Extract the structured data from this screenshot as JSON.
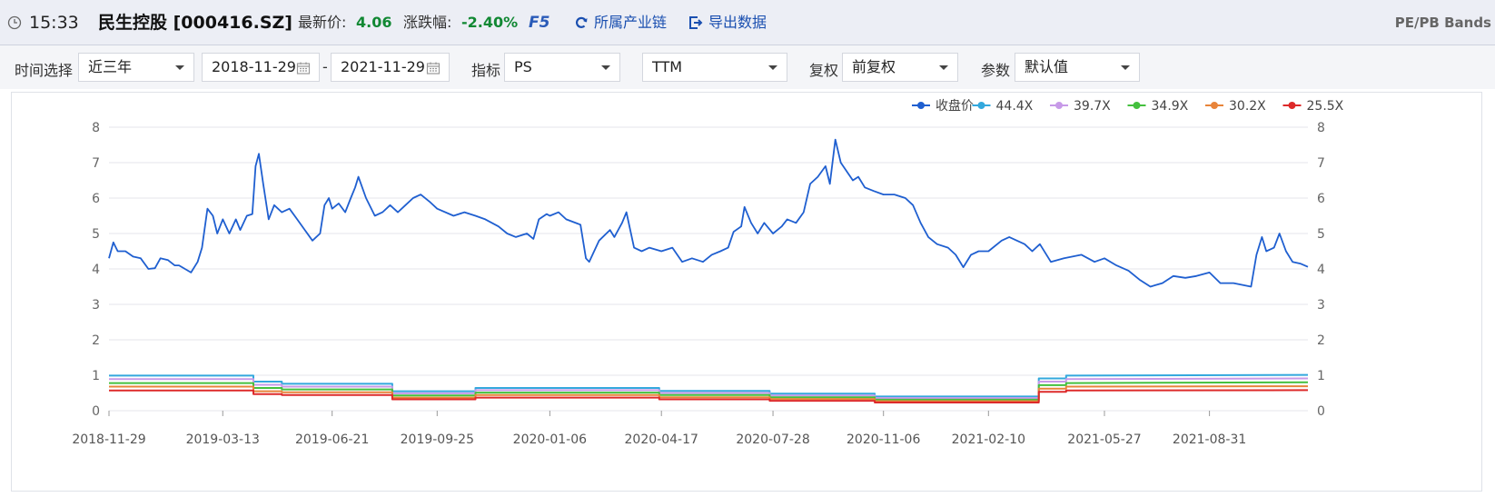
{
  "header": {
    "time": "15:33",
    "stock": "民生控股 [000416.SZ]",
    "price_label": "最新价:",
    "price_value": "4.06",
    "change_label": "涨跌幅:",
    "change_value": "-2.40%",
    "f5": "F5",
    "chain_link": "所属产业链",
    "export_link": "导出数据",
    "bands_title": "PE/PB Bands",
    "icons": {
      "clock": "clock-icon",
      "chain": "refresh-icon",
      "export": "export-icon"
    },
    "colors": {
      "positive": "#118833",
      "link": "#1a4fb0"
    }
  },
  "toolbar": {
    "time_label": "时间选择",
    "range_value": "近三年",
    "start_date": "2018-11-29",
    "date_dash": "-",
    "end_date": "2021-11-29",
    "metric_label": "指标",
    "metric_value": "PS",
    "period_value": "TTM",
    "adjust_label": "复权",
    "adjust_value": "前复权",
    "param_label": "参数",
    "param_value": "默认值"
  },
  "chart_data": {
    "type": "line",
    "x_ticks": [
      "2018-11-29",
      "2019-03-13",
      "2019-06-21",
      "2019-09-25",
      "2020-01-06",
      "2020-04-17",
      "2020-07-28",
      "2020-11-06",
      "2021-02-10",
      "2021-05-27",
      "2021-08-31"
    ],
    "ylim": [
      0,
      8
    ],
    "y_ticks": [
      0,
      1,
      2,
      3,
      4,
      5,
      6,
      7,
      8
    ],
    "grid": true,
    "legend_position": "top-right",
    "series": [
      {
        "name": "收盘价",
        "color": "#1f5fd0",
        "type": "close",
        "points": [
          [
            "2018-11-29",
            4.3
          ],
          [
            "2018-12-03",
            4.75
          ],
          [
            "2018-12-07",
            4.5
          ],
          [
            "2018-12-14",
            4.5
          ],
          [
            "2018-12-21",
            4.35
          ],
          [
            "2018-12-28",
            4.3
          ],
          [
            "2019-01-04",
            4.0
          ],
          [
            "2019-01-10",
            4.02
          ],
          [
            "2019-01-15",
            4.3
          ],
          [
            "2019-01-22",
            4.25
          ],
          [
            "2019-01-28",
            4.1
          ],
          [
            "2019-02-01",
            4.1
          ],
          [
            "2019-02-12",
            3.9
          ],
          [
            "2019-02-18",
            4.2
          ],
          [
            "2019-02-22",
            4.6
          ],
          [
            "2019-02-27",
            5.7
          ],
          [
            "2019-03-04",
            5.5
          ],
          [
            "2019-03-08",
            5.0
          ],
          [
            "2019-03-13",
            5.4
          ],
          [
            "2019-03-19",
            5.0
          ],
          [
            "2019-03-25",
            5.4
          ],
          [
            "2019-03-29",
            5.1
          ],
          [
            "2019-04-04",
            5.5
          ],
          [
            "2019-04-09",
            5.55
          ],
          [
            "2019-04-12",
            6.9
          ],
          [
            "2019-04-15",
            7.25
          ],
          [
            "2019-04-19",
            6.4
          ],
          [
            "2019-04-24",
            5.4
          ],
          [
            "2019-04-29",
            5.8
          ],
          [
            "2019-05-06",
            5.6
          ],
          [
            "2019-05-13",
            5.7
          ],
          [
            "2019-05-20",
            5.4
          ],
          [
            "2019-05-27",
            5.1
          ],
          [
            "2019-06-03",
            4.8
          ],
          [
            "2019-06-10",
            5.0
          ],
          [
            "2019-06-14",
            5.8
          ],
          [
            "2019-06-18",
            6.0
          ],
          [
            "2019-06-21",
            5.7
          ],
          [
            "2019-06-27",
            5.85
          ],
          [
            "2019-07-03",
            5.6
          ],
          [
            "2019-07-08",
            6.0
          ],
          [
            "2019-07-12",
            6.3
          ],
          [
            "2019-07-15",
            6.6
          ],
          [
            "2019-07-22",
            6.0
          ],
          [
            "2019-07-30",
            5.5
          ],
          [
            "2019-08-06",
            5.6
          ],
          [
            "2019-08-13",
            5.8
          ],
          [
            "2019-08-20",
            5.6
          ],
          [
            "2019-08-27",
            5.8
          ],
          [
            "2019-09-03",
            6.0
          ],
          [
            "2019-09-10",
            6.1
          ],
          [
            "2019-09-18",
            5.9
          ],
          [
            "2019-09-25",
            5.7
          ],
          [
            "2019-10-10",
            5.5
          ],
          [
            "2019-10-20",
            5.6
          ],
          [
            "2019-10-30",
            5.5
          ],
          [
            "2019-11-08",
            5.4
          ],
          [
            "2019-11-20",
            5.2
          ],
          [
            "2019-11-28",
            5.0
          ],
          [
            "2019-12-06",
            4.9
          ],
          [
            "2019-12-16",
            5.0
          ],
          [
            "2019-12-22",
            4.85
          ],
          [
            "2019-12-27",
            5.4
          ],
          [
            "2020-01-03",
            5.55
          ],
          [
            "2020-01-06",
            5.5
          ],
          [
            "2020-01-14",
            5.6
          ],
          [
            "2020-01-21",
            5.4
          ],
          [
            "2020-02-03",
            5.25
          ],
          [
            "2020-02-08",
            4.3
          ],
          [
            "2020-02-11",
            4.2
          ],
          [
            "2020-02-20",
            4.8
          ],
          [
            "2020-03-01",
            5.1
          ],
          [
            "2020-03-05",
            4.9
          ],
          [
            "2020-03-12",
            5.3
          ],
          [
            "2020-03-16",
            5.6
          ],
          [
            "2020-03-23",
            4.6
          ],
          [
            "2020-03-30",
            4.5
          ],
          [
            "2020-04-06",
            4.6
          ],
          [
            "2020-04-17",
            4.5
          ],
          [
            "2020-04-27",
            4.6
          ],
          [
            "2020-05-06",
            4.2
          ],
          [
            "2020-05-15",
            4.3
          ],
          [
            "2020-05-25",
            4.2
          ],
          [
            "2020-06-02",
            4.4
          ],
          [
            "2020-06-10",
            4.5
          ],
          [
            "2020-06-17",
            4.6
          ],
          [
            "2020-06-22",
            5.05
          ],
          [
            "2020-06-29",
            5.2
          ],
          [
            "2020-07-02",
            5.75
          ],
          [
            "2020-07-08",
            5.3
          ],
          [
            "2020-07-14",
            5.0
          ],
          [
            "2020-07-20",
            5.3
          ],
          [
            "2020-07-28",
            5.0
          ],
          [
            "2020-08-05",
            5.2
          ],
          [
            "2020-08-10",
            5.4
          ],
          [
            "2020-08-18",
            5.3
          ],
          [
            "2020-08-25",
            5.6
          ],
          [
            "2020-08-31",
            6.4
          ],
          [
            "2020-09-07",
            6.6
          ],
          [
            "2020-09-14",
            6.9
          ],
          [
            "2020-09-18",
            6.4
          ],
          [
            "2020-09-23",
            7.65
          ],
          [
            "2020-09-28",
            7.0
          ],
          [
            "2020-10-09",
            6.5
          ],
          [
            "2020-10-14",
            6.6
          ],
          [
            "2020-10-20",
            6.3
          ],
          [
            "2020-10-28",
            6.2
          ],
          [
            "2020-11-06",
            6.1
          ],
          [
            "2020-11-16",
            6.1
          ],
          [
            "2020-11-26",
            6.0
          ],
          [
            "2020-12-03",
            5.8
          ],
          [
            "2020-12-10",
            5.3
          ],
          [
            "2020-12-17",
            4.9
          ],
          [
            "2020-12-25",
            4.7
          ],
          [
            "2021-01-04",
            4.6
          ],
          [
            "2021-01-11",
            4.4
          ],
          [
            "2021-01-18",
            4.05
          ],
          [
            "2021-01-25",
            4.4
          ],
          [
            "2021-02-01",
            4.5
          ],
          [
            "2021-02-10",
            4.5
          ],
          [
            "2021-02-22",
            4.8
          ],
          [
            "2021-03-01",
            4.9
          ],
          [
            "2021-03-08",
            4.8
          ],
          [
            "2021-03-15",
            4.7
          ],
          [
            "2021-03-22",
            4.5
          ],
          [
            "2021-03-29",
            4.7
          ],
          [
            "2021-04-08",
            4.2
          ],
          [
            "2021-04-20",
            4.3
          ],
          [
            "2021-05-06",
            4.4
          ],
          [
            "2021-05-18",
            4.2
          ],
          [
            "2021-05-27",
            4.3
          ],
          [
            "2021-06-07",
            4.1
          ],
          [
            "2021-06-18",
            3.95
          ],
          [
            "2021-06-28",
            3.7
          ],
          [
            "2021-07-08",
            3.5
          ],
          [
            "2021-07-19",
            3.6
          ],
          [
            "2021-07-29",
            3.8
          ],
          [
            "2021-08-09",
            3.75
          ],
          [
            "2021-08-19",
            3.8
          ],
          [
            "2021-08-31",
            3.9
          ],
          [
            "2021-09-10",
            3.6
          ],
          [
            "2021-09-22",
            3.6
          ],
          [
            "2021-10-08",
            3.5
          ],
          [
            "2021-10-13",
            4.4
          ],
          [
            "2021-10-18",
            4.9
          ],
          [
            "2021-10-22",
            4.5
          ],
          [
            "2021-10-29",
            4.6
          ],
          [
            "2021-11-03",
            5.0
          ],
          [
            "2021-11-09",
            4.5
          ],
          [
            "2021-11-15",
            4.2
          ],
          [
            "2021-11-22",
            4.15
          ],
          [
            "2021-11-29",
            4.06
          ]
        ]
      },
      {
        "name": "44.4X",
        "color": "#33a8dd",
        "type": "band",
        "points": [
          [
            "2018-11-29",
            0.99
          ],
          [
            "2019-04-10",
            0.99
          ],
          [
            "2019-04-10",
            0.82
          ],
          [
            "2019-05-06",
            0.82
          ],
          [
            "2019-05-06",
            0.76
          ],
          [
            "2019-08-15",
            0.76
          ],
          [
            "2019-08-15",
            0.55
          ],
          [
            "2019-10-30",
            0.55
          ],
          [
            "2019-10-30",
            0.64
          ],
          [
            "2020-04-15",
            0.64
          ],
          [
            "2020-04-15",
            0.56
          ],
          [
            "2020-07-25",
            0.56
          ],
          [
            "2020-07-25",
            0.48
          ],
          [
            "2020-10-29",
            0.48
          ],
          [
            "2020-10-29",
            0.4
          ],
          [
            "2021-03-28",
            0.4
          ],
          [
            "2021-03-28",
            0.91
          ],
          [
            "2021-04-22",
            0.91
          ],
          [
            "2021-04-22",
            0.99
          ],
          [
            "2021-11-29",
            1.01
          ]
        ]
      },
      {
        "name": "39.7X",
        "color": "#c79ae8",
        "type": "band",
        "points": [
          [
            "2018-11-29",
            0.89
          ],
          [
            "2019-04-10",
            0.89
          ],
          [
            "2019-04-10",
            0.73
          ],
          [
            "2019-05-06",
            0.73
          ],
          [
            "2019-05-06",
            0.68
          ],
          [
            "2019-08-15",
            0.68
          ],
          [
            "2019-08-15",
            0.49
          ],
          [
            "2019-10-30",
            0.49
          ],
          [
            "2019-10-30",
            0.58
          ],
          [
            "2020-04-15",
            0.58
          ],
          [
            "2020-04-15",
            0.5
          ],
          [
            "2020-07-25",
            0.5
          ],
          [
            "2020-07-25",
            0.43
          ],
          [
            "2020-10-29",
            0.43
          ],
          [
            "2020-10-29",
            0.36
          ],
          [
            "2021-03-28",
            0.36
          ],
          [
            "2021-03-28",
            0.82
          ],
          [
            "2021-04-22",
            0.82
          ],
          [
            "2021-04-22",
            0.89
          ],
          [
            "2021-11-29",
            0.91
          ]
        ]
      },
      {
        "name": "34.9X",
        "color": "#44c03e",
        "type": "band",
        "points": [
          [
            "2018-11-29",
            0.78
          ],
          [
            "2019-04-10",
            0.78
          ],
          [
            "2019-04-10",
            0.64
          ],
          [
            "2019-05-06",
            0.64
          ],
          [
            "2019-05-06",
            0.6
          ],
          [
            "2019-08-15",
            0.6
          ],
          [
            "2019-08-15",
            0.43
          ],
          [
            "2019-10-30",
            0.43
          ],
          [
            "2019-10-30",
            0.51
          ],
          [
            "2020-04-15",
            0.51
          ],
          [
            "2020-04-15",
            0.44
          ],
          [
            "2020-07-25",
            0.44
          ],
          [
            "2020-07-25",
            0.38
          ],
          [
            "2020-10-29",
            0.38
          ],
          [
            "2020-10-29",
            0.31
          ],
          [
            "2021-03-28",
            0.31
          ],
          [
            "2021-03-28",
            0.72
          ],
          [
            "2021-04-22",
            0.72
          ],
          [
            "2021-04-22",
            0.78
          ],
          [
            "2021-11-29",
            0.8
          ]
        ]
      },
      {
        "name": "30.2X",
        "color": "#e8843a",
        "type": "band",
        "points": [
          [
            "2018-11-29",
            0.68
          ],
          [
            "2019-04-10",
            0.68
          ],
          [
            "2019-04-10",
            0.55
          ],
          [
            "2019-05-06",
            0.55
          ],
          [
            "2019-05-06",
            0.52
          ],
          [
            "2019-08-15",
            0.52
          ],
          [
            "2019-08-15",
            0.37
          ],
          [
            "2019-10-30",
            0.37
          ],
          [
            "2019-10-30",
            0.44
          ],
          [
            "2020-04-15",
            0.44
          ],
          [
            "2020-04-15",
            0.38
          ],
          [
            "2020-07-25",
            0.38
          ],
          [
            "2020-07-25",
            0.33
          ],
          [
            "2020-10-29",
            0.33
          ],
          [
            "2020-10-29",
            0.27
          ],
          [
            "2021-03-28",
            0.27
          ],
          [
            "2021-03-28",
            0.62
          ],
          [
            "2021-04-22",
            0.62
          ],
          [
            "2021-04-22",
            0.68
          ],
          [
            "2021-11-29",
            0.69
          ]
        ]
      },
      {
        "name": "25.5X",
        "color": "#dd2a2a",
        "type": "band",
        "points": [
          [
            "2018-11-29",
            0.57
          ],
          [
            "2019-04-10",
            0.57
          ],
          [
            "2019-04-10",
            0.47
          ],
          [
            "2019-05-06",
            0.47
          ],
          [
            "2019-05-06",
            0.44
          ],
          [
            "2019-08-15",
            0.44
          ],
          [
            "2019-08-15",
            0.32
          ],
          [
            "2019-10-30",
            0.32
          ],
          [
            "2019-10-30",
            0.37
          ],
          [
            "2020-04-15",
            0.37
          ],
          [
            "2020-04-15",
            0.32
          ],
          [
            "2020-07-25",
            0.32
          ],
          [
            "2020-07-25",
            0.28
          ],
          [
            "2020-10-29",
            0.28
          ],
          [
            "2020-10-29",
            0.23
          ],
          [
            "2021-03-28",
            0.23
          ],
          [
            "2021-03-28",
            0.53
          ],
          [
            "2021-04-22",
            0.53
          ],
          [
            "2021-04-22",
            0.57
          ],
          [
            "2021-11-29",
            0.58
          ]
        ]
      }
    ]
  }
}
